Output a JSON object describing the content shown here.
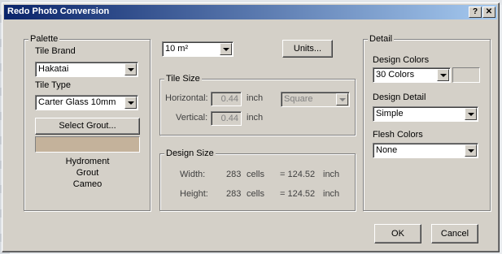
{
  "dialog": {
    "title": "Redo Photo Conversion"
  },
  "titlebar": {
    "help_label": "?",
    "close_label": "✕"
  },
  "palette": {
    "legend": "Palette",
    "tile_brand_label": "Tile Brand",
    "tile_brand_value": "Hakatai",
    "tile_type_label": "Tile Type",
    "tile_type_value": "Carter Glass 10mm",
    "select_grout_label": "Select Grout...",
    "grout_color": "#c4b29b",
    "grout_info": [
      "Hydroment",
      "Grout",
      "Cameo"
    ]
  },
  "area": {
    "value": "10 m²"
  },
  "units_button_label": "Units...",
  "tile_size": {
    "legend": "Tile Size",
    "horizontal_label": "Horizontal:",
    "horizontal_value": "0.44",
    "horizontal_unit": "inch",
    "vertical_label": "Vertical:",
    "vertical_value": "0.44",
    "vertical_unit": "inch",
    "shape_value": "Square"
  },
  "design_size": {
    "legend": "Design Size",
    "width_label": "Width:",
    "width_cells": "283",
    "width_unit": "cells",
    "width_eq": "= 124.52",
    "width_eq_unit": "inch",
    "height_label": "Height:",
    "height_cells": "283",
    "height_unit": "cells",
    "height_eq": "= 124.52",
    "height_eq_unit": "inch"
  },
  "detail": {
    "legend": "Detail",
    "design_colors_label": "Design Colors",
    "design_colors_value": "30 Colors",
    "design_detail_label": "Design Detail",
    "design_detail_value": "Simple",
    "flesh_colors_label": "Flesh Colors",
    "flesh_colors_value": "None"
  },
  "buttons": {
    "ok": "OK",
    "cancel": "Cancel"
  }
}
